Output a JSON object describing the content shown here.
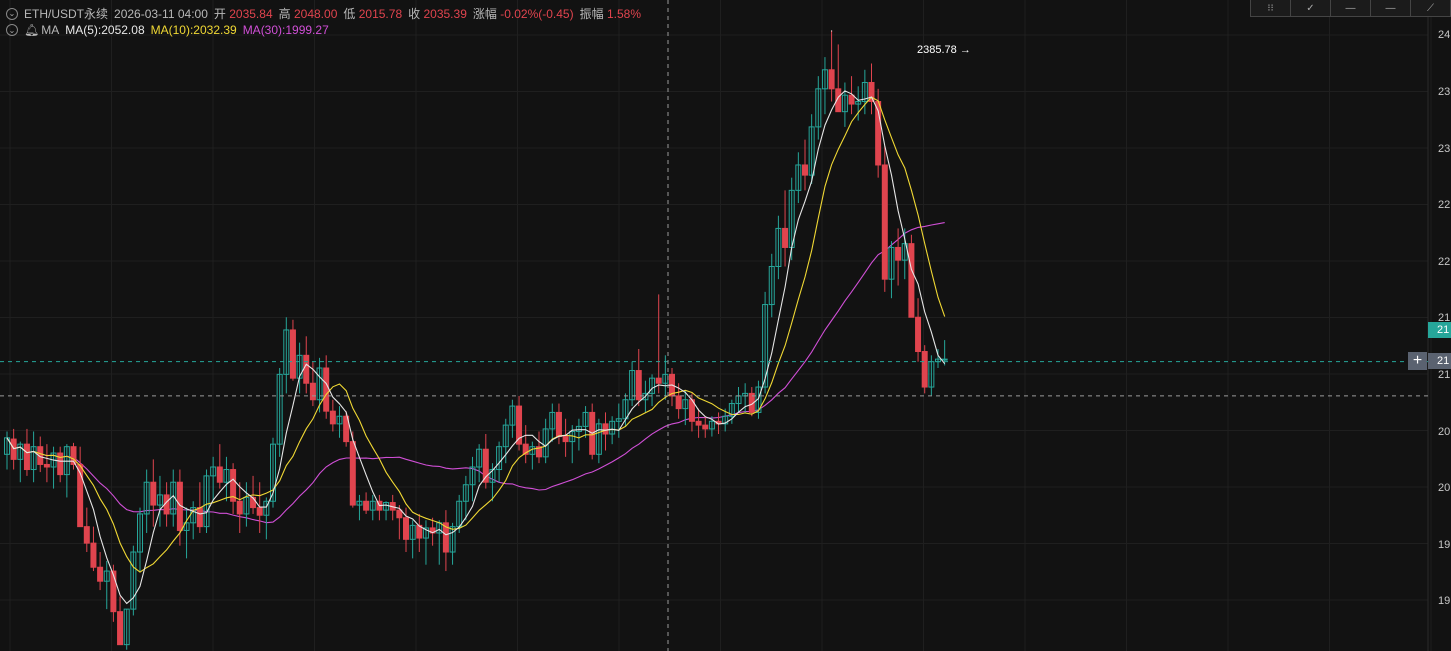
{
  "header": {
    "symbol": "ETH/USDT永续",
    "datetime": "2026-03-11 04:00",
    "open_label": "开",
    "open": "2035.84",
    "high_label": "高",
    "high": "2048.00",
    "low_label": "低",
    "low": "2015.78",
    "close_label": "收",
    "close": "2035.39",
    "change_label": "涨幅",
    "change": "-0.02%(-0.45)",
    "amplitude_label": "振幅",
    "amplitude": "1.58%"
  },
  "indicator": {
    "name": "MA",
    "ma5": "MA(5):2052.08",
    "ma10": "MA(10):2032.39",
    "ma30": "MA(30):1999.27"
  },
  "toolbar": {
    "icons": [
      "grid-icon",
      "check-icon",
      "line-icon",
      "line-icon",
      "line-icon"
    ]
  },
  "high_marker": {
    "label": "2385.78",
    "arrow": "→"
  },
  "price_axis": {
    "labels": [
      "24",
      "23",
      "23",
      "22",
      "22",
      "21",
      "21",
      "20",
      "20",
      "19",
      "19"
    ],
    "current_tag": "21",
    "crosshair_tag": "21",
    "plus": "+"
  },
  "chart_data": {
    "type": "candlestick",
    "title": "ETH/USDT永续",
    "interval_description": "4h candles",
    "ylim": [
      1897,
      2410
    ],
    "grid": true,
    "colors": {
      "up": "#26a69a",
      "down": "#e0444e",
      "ma5": "#e6e6e6",
      "ma10": "#f0d834",
      "ma30": "#d04fd6",
      "background": "#121212"
    },
    "current_price_line": 2125,
    "crosshair_price": 2098,
    "ohlc_note": "open, high, low, close",
    "candles": [
      [
        2052,
        2070,
        2040,
        2065
      ],
      [
        2064,
        2072,
        2040,
        2048
      ],
      [
        2048,
        2062,
        2030,
        2060
      ],
      [
        2060,
        2072,
        2035,
        2040
      ],
      [
        2040,
        2070,
        2030,
        2058
      ],
      [
        2058,
        2066,
        2038,
        2044
      ],
      [
        2044,
        2060,
        2030,
        2042
      ],
      [
        2042,
        2058,
        2025,
        2053
      ],
      [
        2053,
        2058,
        2030,
        2036
      ],
      [
        2036,
        2060,
        2018,
        2058
      ],
      [
        2058,
        2061,
        2040,
        2044
      ],
      [
        2044,
        2058,
        2010,
        1995
      ],
      [
        1995,
        2010,
        1975,
        1982
      ],
      [
        1982,
        1995,
        1960,
        1963
      ],
      [
        1963,
        1975,
        1945,
        1952
      ],
      [
        1952,
        1968,
        1930,
        1960
      ],
      [
        1960,
        1965,
        1920,
        1928
      ],
      [
        1928,
        1940,
        1905,
        1902
      ],
      [
        1902,
        1930,
        1898,
        1930
      ],
      [
        1930,
        1980,
        1925,
        1975
      ],
      [
        1975,
        2010,
        1960,
        2005
      ],
      [
        2005,
        2040,
        1990,
        2030
      ],
      [
        2030,
        2048,
        1995,
        2012
      ],
      [
        2012,
        2035,
        1995,
        2020
      ],
      [
        2020,
        2030,
        1995,
        2005
      ],
      [
        2005,
        2040,
        1995,
        2030
      ],
      [
        2030,
        2040,
        1980,
        1992
      ],
      [
        1992,
        2010,
        1970,
        1998
      ],
      [
        1998,
        2015,
        1985,
        2010
      ],
      [
        2010,
        2030,
        1990,
        1995
      ],
      [
        1995,
        2040,
        1990,
        2035
      ],
      [
        2035,
        2050,
        2015,
        2042
      ],
      [
        2042,
        2060,
        2025,
        2030
      ],
      [
        2030,
        2050,
        2015,
        2040
      ],
      [
        2040,
        2045,
        2005,
        2015
      ],
      [
        2015,
        2030,
        1990,
        2005
      ],
      [
        2005,
        2030,
        1995,
        2018
      ],
      [
        2018,
        2035,
        2005,
        2010
      ],
      [
        2010,
        2030,
        1990,
        2004
      ],
      [
        2004,
        2018,
        1985,
        2015
      ],
      [
        2015,
        2065,
        2010,
        2060
      ],
      [
        2060,
        2120,
        2050,
        2115
      ],
      [
        2115,
        2160,
        2100,
        2150
      ],
      [
        2150,
        2158,
        2110,
        2112
      ],
      [
        2112,
        2140,
        2100,
        2130
      ],
      [
        2130,
        2145,
        2100,
        2108
      ],
      [
        2108,
        2125,
        2090,
        2095
      ],
      [
        2095,
        2128,
        2085,
        2120
      ],
      [
        2120,
        2130,
        2080,
        2086
      ],
      [
        2086,
        2095,
        2070,
        2076
      ],
      [
        2076,
        2090,
        2065,
        2082
      ],
      [
        2082,
        2086,
        2058,
        2062
      ],
      [
        2062,
        2070,
        2010,
        2012
      ],
      [
        2012,
        2020,
        2000,
        2015
      ],
      [
        2015,
        2022,
        2005,
        2008
      ],
      [
        2008,
        2020,
        2000,
        2015
      ],
      [
        2015,
        2020,
        2000,
        2008
      ],
      [
        2008,
        2015,
        2000,
        2014
      ],
      [
        2014,
        2020,
        2000,
        2008
      ],
      [
        2008,
        2012,
        1985,
        2002
      ],
      [
        2002,
        2010,
        1975,
        1985
      ],
      [
        1985,
        2000,
        1970,
        1996
      ],
      [
        1996,
        2005,
        1975,
        1986
      ],
      [
        1986,
        2000,
        1965,
        1994
      ],
      [
        1994,
        2002,
        1980,
        1990
      ],
      [
        1990,
        2000,
        1965,
        1998
      ],
      [
        1998,
        2008,
        1960,
        1975
      ],
      [
        1975,
        1998,
        1965,
        1995
      ],
      [
        1995,
        2020,
        1990,
        2015
      ],
      [
        2015,
        2035,
        2000,
        2028
      ],
      [
        2028,
        2050,
        2015,
        2042
      ],
      [
        2042,
        2060,
        2030,
        2056
      ],
      [
        2056,
        2068,
        2025,
        2030
      ],
      [
        2030,
        2045,
        2015,
        2040
      ],
      [
        2040,
        2062,
        2030,
        2058
      ],
      [
        2058,
        2080,
        2045,
        2075
      ],
      [
        2075,
        2095,
        2065,
        2090
      ],
      [
        2090,
        2098,
        2055,
        2060
      ],
      [
        2060,
        2075,
        2045,
        2052
      ],
      [
        2052,
        2062,
        2040,
        2058
      ],
      [
        2058,
        2070,
        2045,
        2050
      ],
      [
        2050,
        2080,
        2045,
        2072
      ],
      [
        2072,
        2092,
        2062,
        2085
      ],
      [
        2085,
        2092,
        2060,
        2066
      ],
      [
        2066,
        2080,
        2050,
        2062
      ],
      [
        2062,
        2075,
        2045,
        2070
      ],
      [
        2070,
        2080,
        2055,
        2074
      ],
      [
        2074,
        2090,
        2065,
        2085
      ],
      [
        2085,
        2092,
        2048,
        2052
      ],
      [
        2052,
        2080,
        2045,
        2076
      ],
      [
        2076,
        2085,
        2055,
        2068
      ],
      [
        2068,
        2082,
        2060,
        2078
      ],
      [
        2078,
        2092,
        2065,
        2080
      ],
      [
        2080,
        2100,
        2074,
        2095
      ],
      [
        2095,
        2125,
        2090,
        2118
      ],
      [
        2118,
        2135,
        2090,
        2095
      ],
      [
        2095,
        2110,
        2085,
        2100
      ],
      [
        2100,
        2115,
        2090,
        2112
      ],
      [
        2112,
        2178,
        2100,
        2108
      ],
      [
        2108,
        2130,
        2095,
        2115
      ],
      [
        2115,
        2120,
        2090,
        2098
      ],
      [
        2098,
        2108,
        2080,
        2088
      ],
      [
        2088,
        2102,
        2075,
        2095
      ],
      [
        2095,
        2100,
        2070,
        2078
      ],
      [
        2078,
        2088,
        2065,
        2075
      ],
      [
        2075,
        2082,
        2065,
        2072
      ],
      [
        2072,
        2082,
        2066,
        2078
      ],
      [
        2078,
        2085,
        2068,
        2076
      ],
      [
        2076,
        2088,
        2070,
        2082
      ],
      [
        2082,
        2095,
        2076,
        2092
      ],
      [
        2092,
        2105,
        2085,
        2098
      ],
      [
        2098,
        2108,
        2085,
        2100
      ],
      [
        2100,
        2105,
        2082,
        2085
      ],
      [
        2085,
        2110,
        2080,
        2105
      ],
      [
        2105,
        2180,
        2100,
        2170
      ],
      [
        2170,
        2210,
        2160,
        2200
      ],
      [
        2200,
        2240,
        2190,
        2230
      ],
      [
        2230,
        2260,
        2200,
        2215
      ],
      [
        2215,
        2270,
        2205,
        2260
      ],
      [
        2260,
        2290,
        2250,
        2280
      ],
      [
        2280,
        2300,
        2260,
        2272
      ],
      [
        2272,
        2320,
        2265,
        2310
      ],
      [
        2310,
        2350,
        2300,
        2340
      ],
      [
        2340,
        2365,
        2320,
        2355
      ],
      [
        2355,
        2386,
        2330,
        2340
      ],
      [
        2340,
        2375,
        2322,
        2322
      ],
      [
        2322,
        2345,
        2310,
        2335
      ],
      [
        2335,
        2350,
        2320,
        2328
      ],
      [
        2328,
        2342,
        2315,
        2330
      ],
      [
        2330,
        2355,
        2320,
        2345
      ],
      [
        2345,
        2360,
        2320,
        2330
      ],
      [
        2330,
        2340,
        2270,
        2280
      ],
      [
        2280,
        2295,
        2180,
        2190
      ],
      [
        2190,
        2220,
        2175,
        2215
      ],
      [
        2215,
        2230,
        2185,
        2205
      ],
      [
        2205,
        2230,
        2190,
        2218
      ],
      [
        2218,
        2225,
        2160,
        2160
      ],
      [
        2160,
        2175,
        2125,
        2133
      ],
      [
        2133,
        2138,
        2100,
        2105
      ],
      [
        2105,
        2130,
        2098,
        2125
      ],
      [
        2125,
        2135,
        2120,
        2127
      ],
      [
        2127,
        2142,
        2122,
        2127
      ]
    ],
    "ma_series": [
      {
        "name": "MA(5)",
        "period": 5,
        "last_value": 2052.08
      },
      {
        "name": "MA(10)",
        "period": 10,
        "last_value": 2032.39
      },
      {
        "name": "MA(30)",
        "period": 30,
        "last_value": 1999.27
      }
    ],
    "annotations": [
      {
        "text": "2385.78",
        "type": "highest"
      }
    ]
  }
}
